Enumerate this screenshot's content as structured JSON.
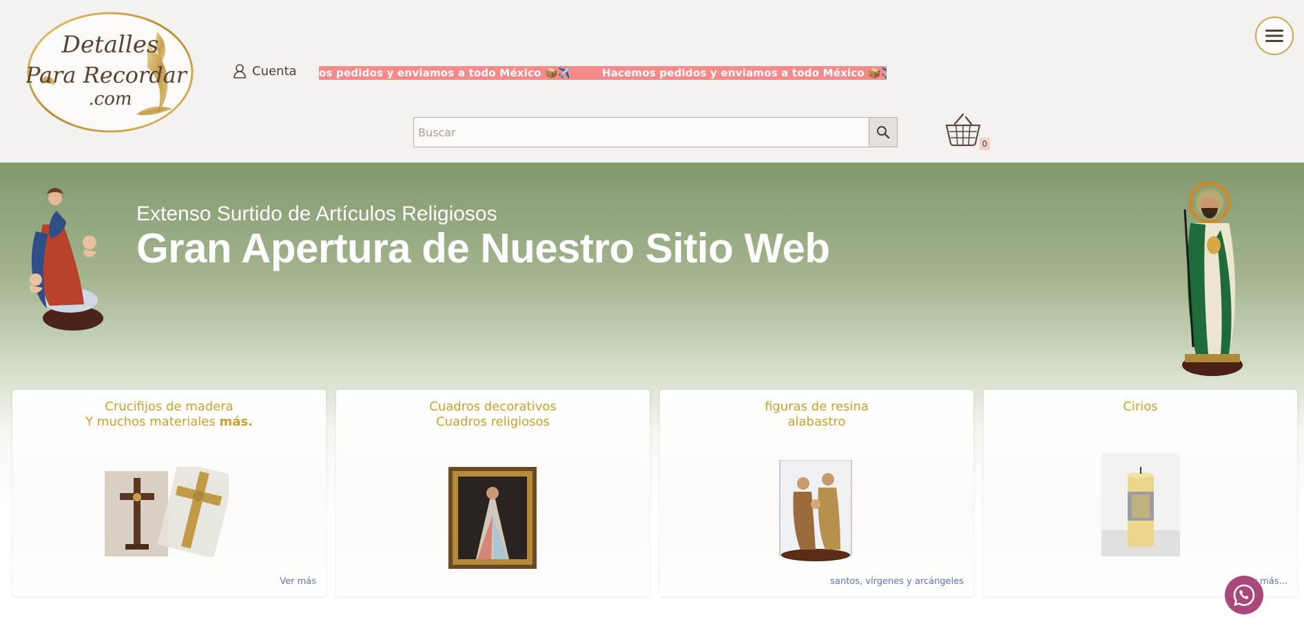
{
  "brand": {
    "logo_line1": "Detalles",
    "logo_line2": "Para Recordar",
    "logo_line3": ".com"
  },
  "header": {
    "account_label": "Cuenta",
    "marquee_text": "Hacemos pedidos y enviamos a todo México 📦✈️",
    "marquee_text_partial": "os pedidos y enviamos a todo México 📦✈️",
    "search_placeholder": "Buscar",
    "cart_count": "0"
  },
  "hero": {
    "subtitle": "Extenso Surtido de Artículos Religiosos",
    "title": "Gran Apertura de Nuestro Sitio Web"
  },
  "cards": [
    {
      "title_line1": "Crucifijos de madera",
      "title_line2": "Y muchos materiales ",
      "title_bold": "más.",
      "link": "Ver más"
    },
    {
      "title_line1": "Cuadros decorativos",
      "title_line2": "Cuadros religiosos",
      "link": ""
    },
    {
      "title_line1": "figuras de resina",
      "title_line2": "alabastro",
      "link": "santos, vírgenes y arcángeles"
    },
    {
      "title_line1": "Cirios",
      "title_line2": "",
      "link": "Ver más..."
    }
  ],
  "colors": {
    "header_bg": "#f4f2f0",
    "marquee_bg": "#f48a8a",
    "accent_gold": "#c9a032",
    "link_blue": "#5a74c4",
    "hero_green": "#83996e",
    "whatsapp": "#a8487b"
  },
  "icons": {
    "account": "user-icon",
    "search": "search-icon",
    "cart": "basket-icon",
    "menu": "hamburger-icon",
    "chat": "whatsapp-icon"
  }
}
